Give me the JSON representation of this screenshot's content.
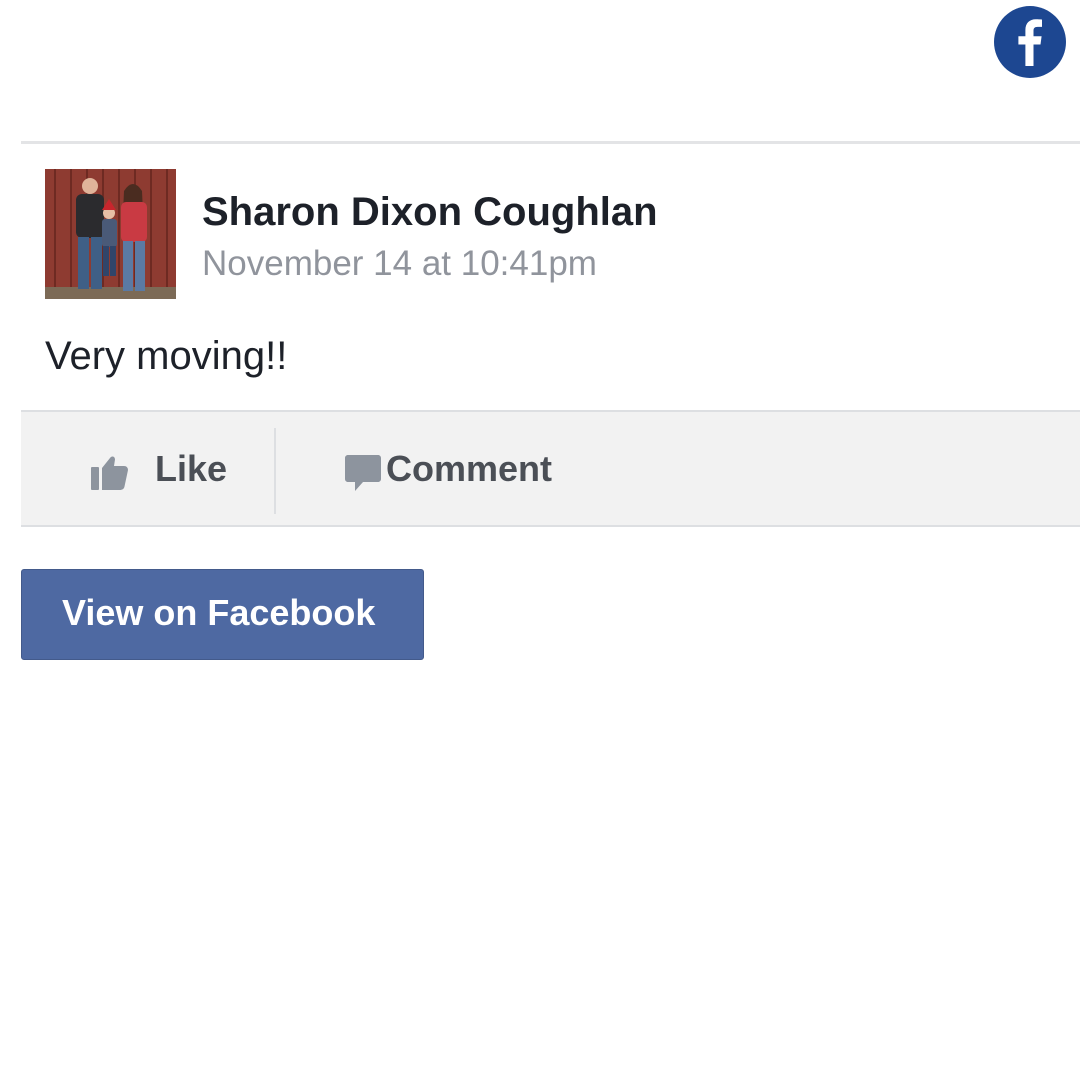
{
  "app": {
    "brand_icon": "facebook-f-icon",
    "brand_color": "#1d4791"
  },
  "post": {
    "author": {
      "name": "Sharon Dixon Coughlan",
      "avatar": "family-photo-avatar"
    },
    "timestamp": "November 14 at 10:41pm",
    "text": "Very moving!!"
  },
  "actions": {
    "like": {
      "label": "Like",
      "icon": "thumbs-up-icon"
    },
    "comment": {
      "label": "Comment",
      "icon": "speech-bubble-icon"
    }
  },
  "view_button": {
    "label": "View on Facebook",
    "color": "#4e69a2"
  },
  "colors": {
    "name_text": "#1d2129",
    "timestamp_text": "#90949c",
    "action_text": "#4b4f56",
    "action_bar_bg": "#f2f2f2"
  }
}
